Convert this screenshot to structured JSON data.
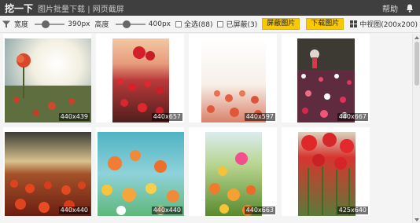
{
  "titlebar": {
    "app_name": "挖一下",
    "subtitle": "图片批量下载 | 网页截屏",
    "help": "帮助",
    "bell_icon": "bell-icon"
  },
  "toolbar": {
    "filter_icon": "filter-icon",
    "width_label": "宽度",
    "width_value": "390px",
    "width_level": 0.33,
    "height_label": "高度",
    "height_value": "400px",
    "height_level": 0.33,
    "select_all": "全选(88)",
    "blocked": "已屏蔽(3)",
    "block_button": "屏蔽图片",
    "download_button": "下载图片",
    "view_label": "中视图(200x200)",
    "view_icon": "grid-icon",
    "accent_color": "#f9c800"
  },
  "images": [
    {
      "size": "440x439"
    },
    {
      "size": "440x657"
    },
    {
      "size": "440x597"
    },
    {
      "size": "440x667"
    },
    {
      "size": "440x440"
    },
    {
      "size": "440x440"
    },
    {
      "size": "440x663"
    },
    {
      "size": "425x640"
    }
  ]
}
